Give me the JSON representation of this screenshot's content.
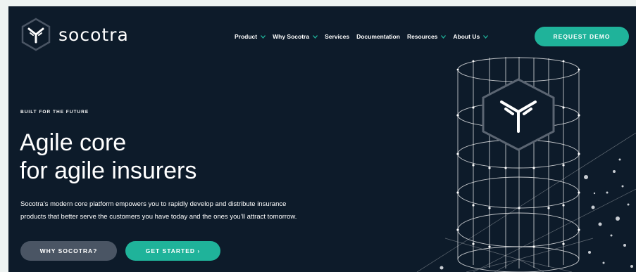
{
  "brand": {
    "name": "socotra",
    "logo_icon": "socotra-hex-logo",
    "accent": "#1fb39a",
    "background": "#0d1b2a"
  },
  "nav": {
    "items": [
      {
        "label": "Product",
        "has_dropdown": true
      },
      {
        "label": "Why Socotra",
        "has_dropdown": true
      },
      {
        "label": "Services",
        "has_dropdown": false
      },
      {
        "label": "Documentation",
        "has_dropdown": false
      },
      {
        "label": "Resources",
        "has_dropdown": true
      },
      {
        "label": "About Us",
        "has_dropdown": true
      }
    ],
    "cta_label": "REQUEST DEMO"
  },
  "hero": {
    "eyebrow": "BUILT FOR THE FUTURE",
    "headline_line1": "Agile core",
    "headline_line2": "for agile insurers",
    "sub_line1": "Socotra’s modern core platform empowers you to rapidly develop and distribute insurance",
    "sub_line2": "products that better serve the customers you have today and the ones you’ll attract tomorrow.",
    "secondary_button": "WHY SOCOTRA?",
    "primary_button": "GET STARTED ›"
  }
}
